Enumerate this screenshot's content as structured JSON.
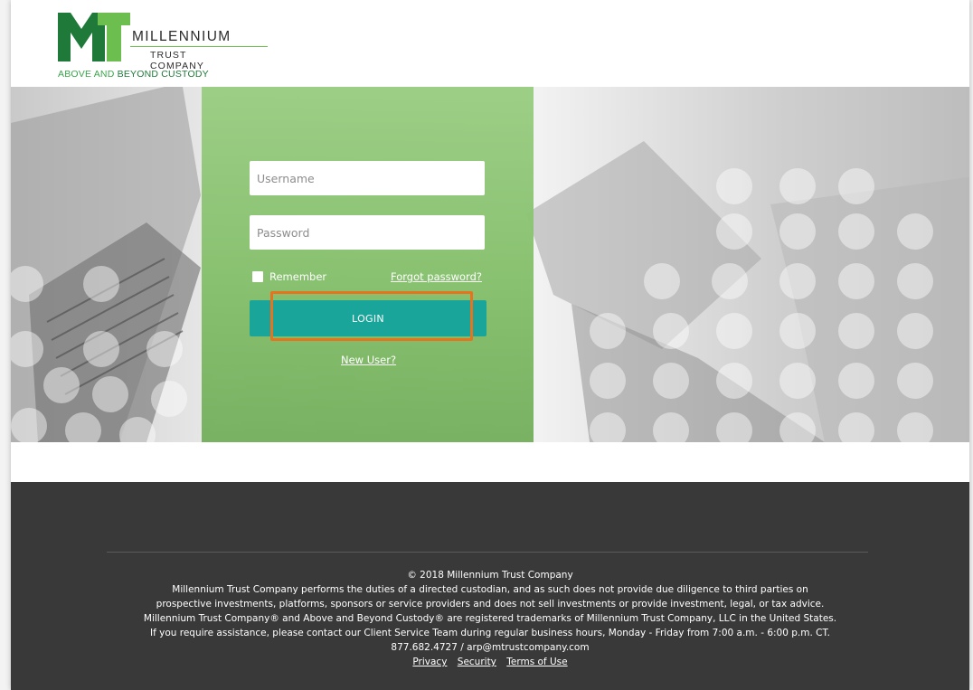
{
  "brand": {
    "name": "MILLENNIUM",
    "sub": "TRUST COMPANY",
    "tagline_part1": "ABOVE AND ",
    "tagline_part2": "BEYOND CUSTODY",
    "colors": {
      "green": "#6cbf4f",
      "dark_green": "#1f7a3a",
      "teal": "#1aa59a",
      "highlight": "#e8731f"
    }
  },
  "login": {
    "username_placeholder": "Username",
    "password_placeholder": "Password",
    "remember_label": "Remember",
    "forgot_label": "Forgot password?",
    "login_label": "LOGIN",
    "new_user_label": "New User?"
  },
  "footer": {
    "copyright": "© 2018 Millennium Trust Company",
    "lines": [
      "Millennium Trust Company performs the duties of a directed custodian, and as such does not provide due diligence to third parties on",
      "prospective investments, platforms, sponsors or service providers and does not sell investments or provide investment, legal, or tax advice.",
      "Millennium Trust Company® and Above and Beyond Custody® are registered trademarks of Millennium Trust Company, LLC in the United States.",
      "If you require assistance, please contact our Client Service Team during regular business hours, Monday - Friday from 7:00 a.m. - 6:00 p.m. CT.",
      "877.682.4727 / arp@mtrustcompany.com"
    ],
    "links": {
      "privacy": "Privacy",
      "security": "Security",
      "terms": "Terms of Use"
    }
  }
}
